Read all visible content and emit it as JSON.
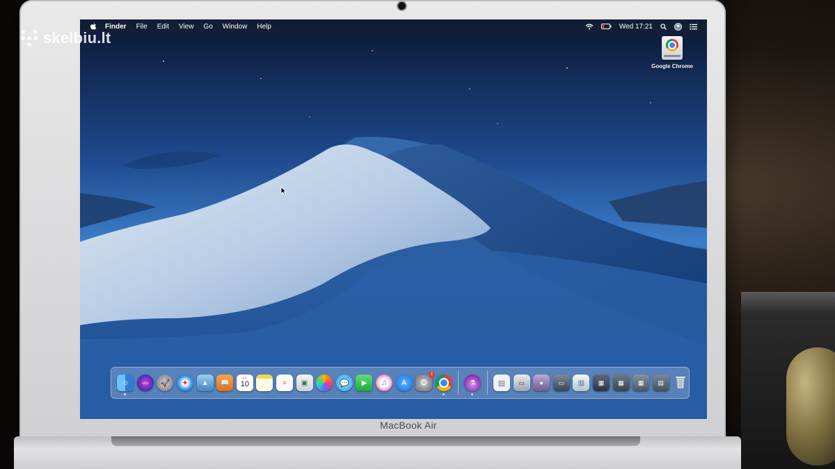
{
  "watermark": {
    "text": "skelbiu.lt"
  },
  "device": {
    "brand_label": "MacBook Air"
  },
  "menubar": {
    "apple_icon": "apple-logo-icon",
    "items": [
      "Finder",
      "File",
      "Edit",
      "View",
      "Go",
      "Window",
      "Help"
    ],
    "clock": "Wed 17:21",
    "status_icons": [
      "wifi-icon",
      "battery-icon",
      "spotlight-search-icon",
      "user-account-icon",
      "notification-center-icon"
    ]
  },
  "desktop": {
    "icons": [
      {
        "label": "Google Chrome",
        "icon": "chrome-drive-icon"
      }
    ]
  },
  "dock": {
    "apps": [
      {
        "name": "finder",
        "icon": "finder-icon",
        "color": "#4aa3e8",
        "running": true
      },
      {
        "name": "siri",
        "icon": "siri-icon",
        "color": "#5b3fc9"
      },
      {
        "name": "launchpad",
        "icon": "launchpad-icon",
        "color": "#9aa3ad"
      },
      {
        "name": "safari",
        "icon": "safari-icon",
        "color": "#2d8fe5"
      },
      {
        "name": "photos-viewer",
        "icon": "image-icon",
        "color": "#6fb0d9"
      },
      {
        "name": "books",
        "icon": "books-icon",
        "color": "#f08a24"
      },
      {
        "name": "calendar",
        "icon": "calendar-icon",
        "color": "#ffffff",
        "calendar_month": "JUL",
        "calendar_day": "10"
      },
      {
        "name": "notes",
        "icon": "notes-icon",
        "color": "#f7e37a"
      },
      {
        "name": "reminders",
        "icon": "reminders-icon",
        "color": "#f4f4f4"
      },
      {
        "name": "preview",
        "icon": "preview-icon",
        "color": "#dfe6ec"
      },
      {
        "name": "photos",
        "icon": "photos-icon",
        "color": "#f1f1f1"
      },
      {
        "name": "messages",
        "icon": "messages-icon",
        "color": "#3fb5f0"
      },
      {
        "name": "facetime",
        "icon": "facetime-icon",
        "color": "#34c759"
      },
      {
        "name": "itunes",
        "icon": "music-icon",
        "color": "#f0f0f5"
      },
      {
        "name": "app-store",
        "icon": "app-store-icon",
        "color": "#1a8cf0"
      },
      {
        "name": "system-preferences",
        "icon": "gear-icon",
        "color": "#8e9399",
        "badge": "1"
      },
      {
        "name": "chrome",
        "icon": "chrome-icon",
        "color": "#ffffff",
        "running": true
      }
    ],
    "extra_apps": [
      {
        "name": "potion-app",
        "icon": "flask-icon",
        "color": "#b45bd1",
        "running": true
      }
    ],
    "stacks": [
      {
        "name": "document",
        "icon": "document-icon",
        "color": "#e9edf2"
      },
      {
        "name": "screenshot-1",
        "icon": "screenshot-icon",
        "color": "#d5dbe2"
      },
      {
        "name": "screenshot-2",
        "icon": "screenshot-icon",
        "color": "#8b7fa8"
      },
      {
        "name": "screenshot-3",
        "icon": "screenshot-icon",
        "color": "#5b6678"
      },
      {
        "name": "file-1",
        "icon": "file-icon",
        "color": "#dfe6ee"
      },
      {
        "name": "window-1",
        "icon": "window-icon",
        "color": "#3f4b5c"
      },
      {
        "name": "window-2",
        "icon": "window-icon",
        "color": "#56606f"
      },
      {
        "name": "window-3",
        "icon": "window-icon",
        "color": "#6b7583"
      },
      {
        "name": "downloads",
        "icon": "downloads-folder-icon",
        "color": "#5f6c7d"
      },
      {
        "name": "trash",
        "icon": "trash-icon",
        "color": "#b6bcc4"
      }
    ]
  }
}
